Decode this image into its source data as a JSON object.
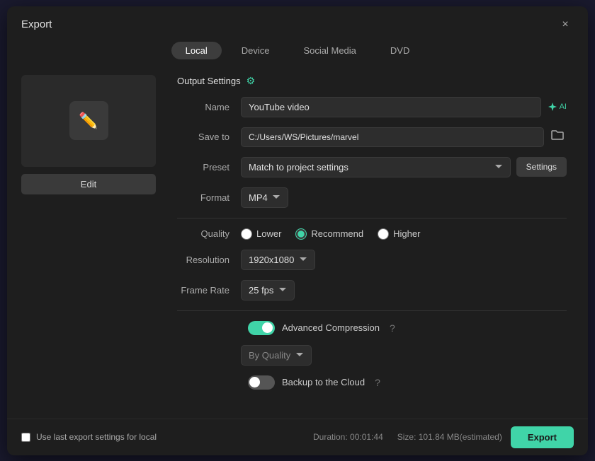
{
  "dialog": {
    "title": "Export",
    "close_label": "×"
  },
  "tabs": [
    {
      "id": "local",
      "label": "Local",
      "active": true
    },
    {
      "id": "device",
      "label": "Device",
      "active": false
    },
    {
      "id": "social_media",
      "label": "Social Media",
      "active": false
    },
    {
      "id": "dvd",
      "label": "DVD",
      "active": false
    }
  ],
  "output_settings": {
    "header": "Output Settings",
    "name_label": "Name",
    "name_value": "YouTube video",
    "ai_label": "AI",
    "save_to_label": "Save to",
    "save_to_value": "C:/Users/WS/Pictures/marvel",
    "preset_label": "Preset",
    "preset_value": "Match to project settings",
    "settings_btn": "Settings",
    "format_label": "Format",
    "format_value": "MP4",
    "quality_label": "Quality",
    "quality_options": [
      {
        "id": "lower",
        "label": "Lower",
        "checked": false
      },
      {
        "id": "recommend",
        "label": "Recommend",
        "checked": true
      },
      {
        "id": "higher",
        "label": "Higher",
        "checked": false
      }
    ],
    "resolution_label": "Resolution",
    "resolution_value": "1920x1080",
    "frame_rate_label": "Frame Rate",
    "frame_rate_value": "25 fps",
    "advanced_compression_label": "Advanced Compression",
    "advanced_compression_enabled": true,
    "by_quality_value": "By Quality",
    "backup_cloud_label": "Backup to the Cloud",
    "backup_cloud_enabled": false
  },
  "preview": {
    "edit_btn": "Edit"
  },
  "footer": {
    "use_last_settings_label": "Use last export settings for local",
    "duration_label": "Duration: 00:01:44",
    "size_label": "Size: 101.84 MB(estimated)",
    "export_btn": "Export"
  }
}
